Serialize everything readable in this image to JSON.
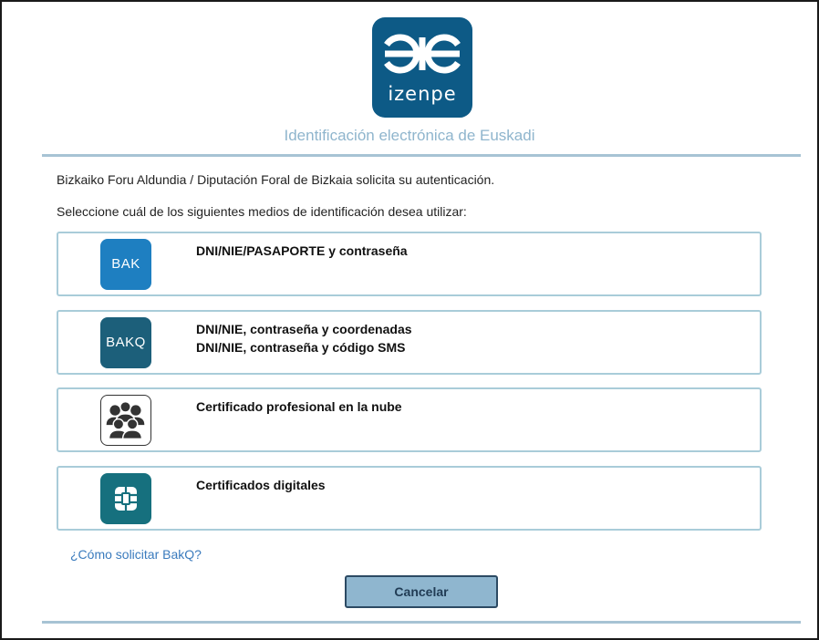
{
  "header": {
    "logo_text": "izenpe",
    "subtitle": "Identificación electrónica de Euskadi"
  },
  "intro": {
    "line1": "Bizkaiko Foru Aldundia / Diputación Foral de Bizkaia solicita su autenticación.",
    "line2": "Seleccione cuál de los siguientes medios de identificación desea utilizar:"
  },
  "options": [
    {
      "icon": "bak-icon",
      "icon_text": "BAK",
      "lines": [
        "DNI/NIE/PASAPORTE y contraseña"
      ]
    },
    {
      "icon": "bakq-icon",
      "icon_text": "BAKQ",
      "lines": [
        "DNI/NIE, contraseña y coordenadas",
        "DNI/NIE, contraseña y código SMS"
      ]
    },
    {
      "icon": "people-group-icon",
      "lines": [
        "Certificado profesional en la nube"
      ]
    },
    {
      "icon": "chip-card-icon",
      "lines": [
        "Certificados digitales"
      ]
    }
  ],
  "help_link": "¿Cómo solicitar BakQ?",
  "cancel_label": "Cancelar",
  "colors": {
    "logo_bg": "#0d5a86",
    "subtitle": "#8fb5cd",
    "divider": "#a7c3d4",
    "option_border": "#a9ccd9",
    "bak_bg": "#1e7fc1",
    "bakq_bg": "#1c5f7a",
    "card_bg": "#16707e",
    "link": "#3a7bbd",
    "button_bg": "#8fb6cf"
  }
}
